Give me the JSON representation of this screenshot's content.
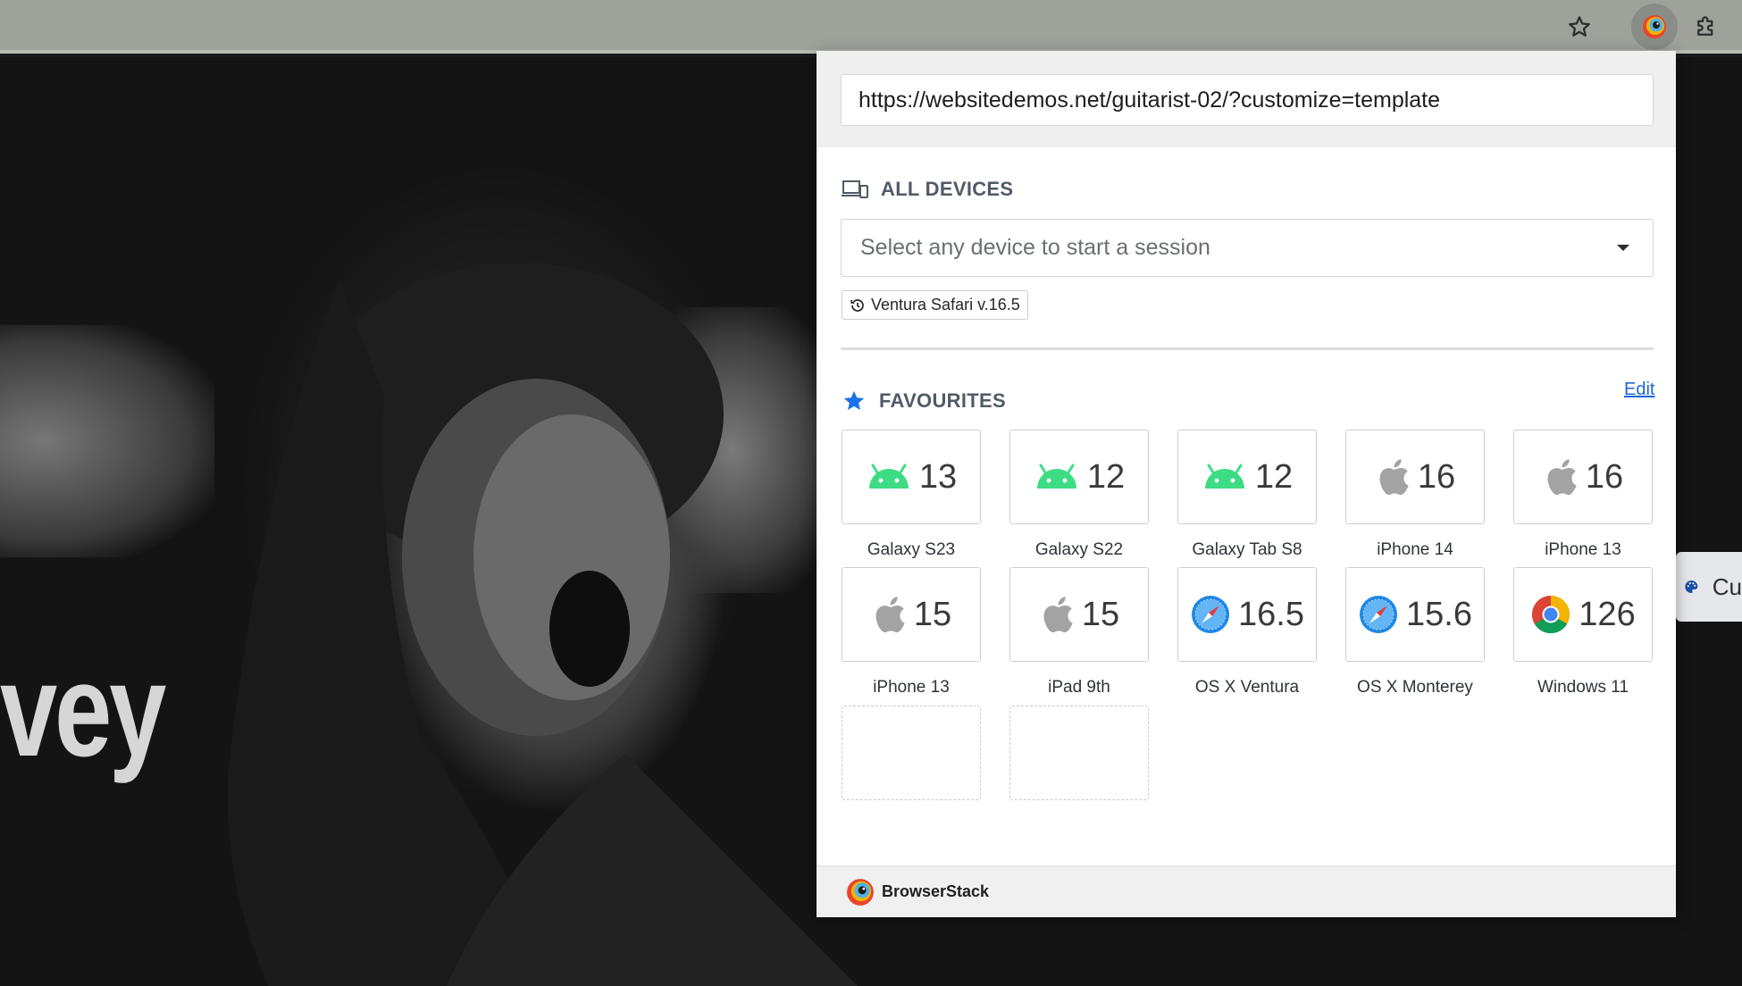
{
  "hero": {
    "text": "vey"
  },
  "customize_tab": {
    "label": "Cu"
  },
  "popup": {
    "url": "https://websitedemos.net/guitarist-02/?customize=template",
    "all_devices": {
      "heading": "ALL DEVICES",
      "select_placeholder": "Select any device to start a session",
      "recent_chip": "Ventura Safari v.16.5"
    },
    "favourites": {
      "heading": "FAVOURITES",
      "edit_label": "Edit",
      "tiles": [
        {
          "icon": "android-icon",
          "version": "13",
          "label": "Galaxy S23"
        },
        {
          "icon": "android-icon",
          "version": "12",
          "label": "Galaxy S22"
        },
        {
          "icon": "android-icon",
          "version": "12",
          "label": "Galaxy Tab S8"
        },
        {
          "icon": "apple-icon",
          "version": "16",
          "label": "iPhone 14"
        },
        {
          "icon": "apple-icon",
          "version": "16",
          "label": "iPhone 13"
        },
        {
          "icon": "apple-icon",
          "version": "15",
          "label": "iPhone 13"
        },
        {
          "icon": "apple-icon",
          "version": "15",
          "label": "iPad 9th"
        },
        {
          "icon": "safari-icon",
          "version": "16.5",
          "label": "OS X Ventura"
        },
        {
          "icon": "safari-icon",
          "version": "15.6",
          "label": "OS X Monterey"
        },
        {
          "icon": "chrome-icon",
          "version": "126",
          "label": "Windows 11"
        }
      ]
    },
    "footer": {
      "brand": "BrowserStack"
    }
  },
  "colors": {
    "android": "#3ddc84",
    "link": "#1c66d6",
    "star": "#1a73e8"
  }
}
